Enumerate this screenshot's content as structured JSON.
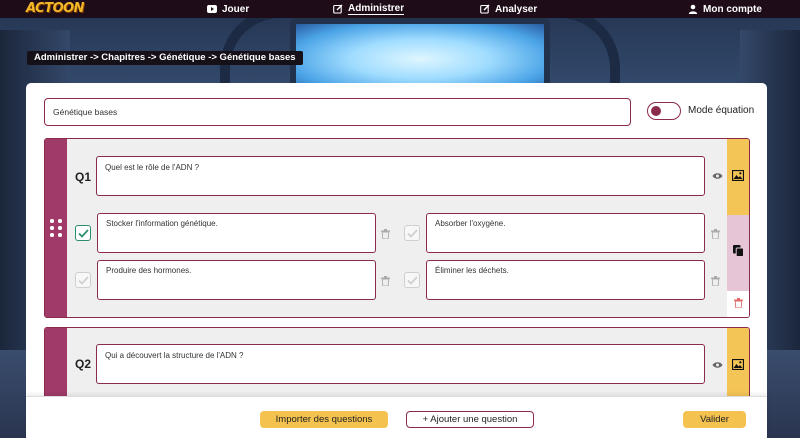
{
  "app": {
    "logo_text": "ACTOON"
  },
  "nav": {
    "jouer": "Jouer",
    "administrer": "Administrer",
    "analyser": "Analyser",
    "mon_compte": "Mon compte"
  },
  "breadcrumb": "Administrer -> Chapitres -> Génétique -> Génétique bases",
  "chapter": {
    "title_value": "Génétique bases",
    "mode_equation_label": "Mode équation",
    "mode_equation_on": true
  },
  "questions": [
    {
      "number": "Q1",
      "text": "Quel est le rôle de l'ADN ?",
      "answers": [
        {
          "text": "Stocker l'information génétique.",
          "correct": true
        },
        {
          "text": "Absorber l'oxygène.",
          "correct": false
        },
        {
          "text": "Produire des hormones.",
          "correct": false
        },
        {
          "text": "Éliminer les déchets.",
          "correct": false
        }
      ]
    },
    {
      "number": "Q2",
      "text": "Qui a découvert la structure de l'ADN ?"
    }
  ],
  "actions": {
    "import": "Importer des questions",
    "add": "+ Ajouter une question",
    "validate": "Valider"
  },
  "icons": {
    "jouer": "youtube-play-icon",
    "administrer": "edit-icon",
    "analyser": "edit-icon",
    "compte": "user-icon",
    "preview": "eye-icon",
    "image": "image-icon",
    "copy": "copy-icon",
    "delete": "trash-icon",
    "drag": "drag-handle-icon"
  },
  "colors": {
    "brand": "#8c2a4b",
    "sidebar": "#a03a68",
    "accent_yellow": "#f3c24f",
    "correct_check": "#2a8e6a"
  }
}
